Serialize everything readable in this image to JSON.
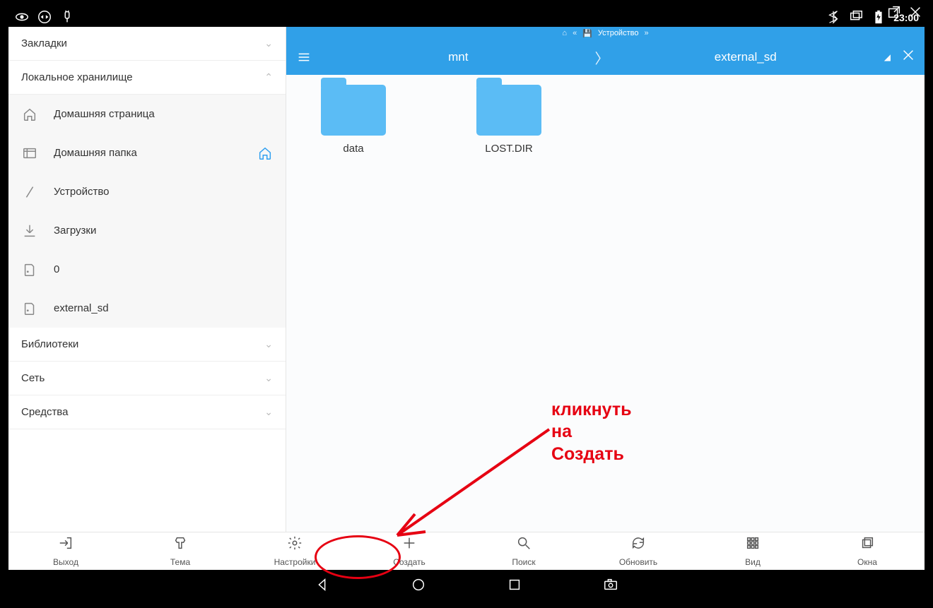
{
  "outer_controls": {
    "popout": "⇱",
    "close": "✕"
  },
  "statusbar": {
    "left_icons": [
      "eye-icon",
      "teamviewer-icon",
      "plug-icon"
    ],
    "right_icons": [
      "bluetooth-icon",
      "windows-icon",
      "battery-icon"
    ],
    "time": "23:00"
  },
  "sidebar": {
    "sections": [
      {
        "label": "Закладки",
        "expanded": false,
        "items": []
      },
      {
        "label": "Локальное хранилище",
        "expanded": true,
        "items": [
          {
            "icon": "home-icon",
            "label": "Домашняя страница",
            "active": false
          },
          {
            "icon": "folder-tree-icon",
            "label": "Домашняя папка",
            "active": true
          },
          {
            "icon": "slash-icon",
            "label": "Устройство",
            "active": false
          },
          {
            "icon": "download-icon",
            "label": "Загрузки",
            "active": false
          },
          {
            "icon": "sd-icon",
            "label": "0",
            "active": false
          },
          {
            "icon": "sd-icon",
            "label": "external_sd",
            "active": false
          }
        ]
      },
      {
        "label": "Библиотеки",
        "expanded": false,
        "items": []
      },
      {
        "label": "Сеть",
        "expanded": false,
        "items": []
      },
      {
        "label": "Средства",
        "expanded": false,
        "items": []
      }
    ]
  },
  "crumbs_top": {
    "items": [
      "home-mini-icon",
      "chevron-mini-icon",
      "device-mini-icon"
    ],
    "label": "Устройство"
  },
  "pathbar": {
    "segments": [
      "mnt",
      "external_sd"
    ]
  },
  "folders": [
    {
      "name": "data"
    },
    {
      "name": "LOST.DIR"
    }
  ],
  "toolbar": [
    {
      "icon": "exit-icon",
      "label": "Выход"
    },
    {
      "icon": "theme-icon",
      "label": "Тема"
    },
    {
      "icon": "settings-icon",
      "label": "Настройки"
    },
    {
      "icon": "plus-icon",
      "label": "Создать"
    },
    {
      "icon": "search-icon",
      "label": "Поиск"
    },
    {
      "icon": "refresh-icon",
      "label": "Обновить"
    },
    {
      "icon": "view-icon",
      "label": "Вид"
    },
    {
      "icon": "windows-tb-icon",
      "label": "Окна"
    }
  ],
  "annotation": {
    "line1": "кликнуть на",
    "line2": "Создать"
  }
}
